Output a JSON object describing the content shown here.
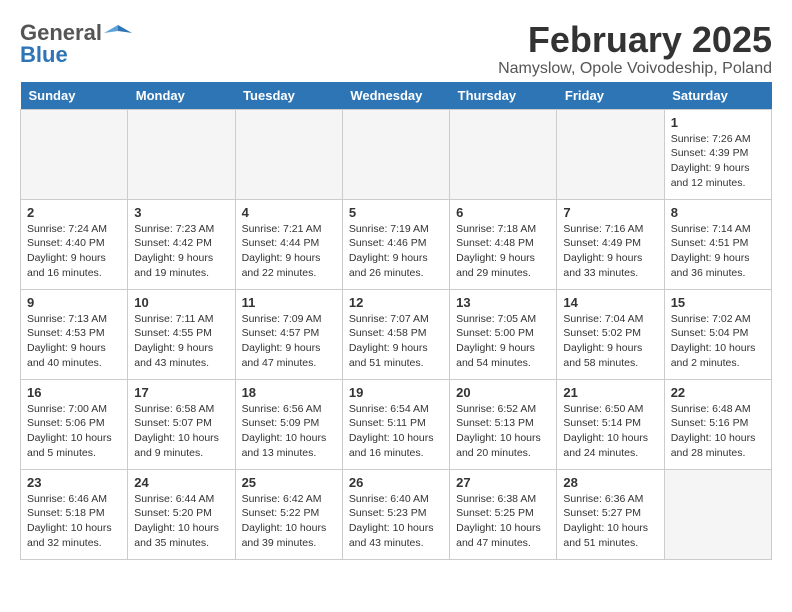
{
  "header": {
    "logo_general": "General",
    "logo_blue": "Blue",
    "title": "February 2025",
    "subtitle": "Namyslow, Opole Voivodeship, Poland"
  },
  "columns": [
    "Sunday",
    "Monday",
    "Tuesday",
    "Wednesday",
    "Thursday",
    "Friday",
    "Saturday"
  ],
  "weeks": [
    [
      {
        "day": "",
        "info": ""
      },
      {
        "day": "",
        "info": ""
      },
      {
        "day": "",
        "info": ""
      },
      {
        "day": "",
        "info": ""
      },
      {
        "day": "",
        "info": ""
      },
      {
        "day": "",
        "info": ""
      },
      {
        "day": "1",
        "info": "Sunrise: 7:26 AM\nSunset: 4:39 PM\nDaylight: 9 hours and 12 minutes."
      }
    ],
    [
      {
        "day": "2",
        "info": "Sunrise: 7:24 AM\nSunset: 4:40 PM\nDaylight: 9 hours and 16 minutes."
      },
      {
        "day": "3",
        "info": "Sunrise: 7:23 AM\nSunset: 4:42 PM\nDaylight: 9 hours and 19 minutes."
      },
      {
        "day": "4",
        "info": "Sunrise: 7:21 AM\nSunset: 4:44 PM\nDaylight: 9 hours and 22 minutes."
      },
      {
        "day": "5",
        "info": "Sunrise: 7:19 AM\nSunset: 4:46 PM\nDaylight: 9 hours and 26 minutes."
      },
      {
        "day": "6",
        "info": "Sunrise: 7:18 AM\nSunset: 4:48 PM\nDaylight: 9 hours and 29 minutes."
      },
      {
        "day": "7",
        "info": "Sunrise: 7:16 AM\nSunset: 4:49 PM\nDaylight: 9 hours and 33 minutes."
      },
      {
        "day": "8",
        "info": "Sunrise: 7:14 AM\nSunset: 4:51 PM\nDaylight: 9 hours and 36 minutes."
      }
    ],
    [
      {
        "day": "9",
        "info": "Sunrise: 7:13 AM\nSunset: 4:53 PM\nDaylight: 9 hours and 40 minutes."
      },
      {
        "day": "10",
        "info": "Sunrise: 7:11 AM\nSunset: 4:55 PM\nDaylight: 9 hours and 43 minutes."
      },
      {
        "day": "11",
        "info": "Sunrise: 7:09 AM\nSunset: 4:57 PM\nDaylight: 9 hours and 47 minutes."
      },
      {
        "day": "12",
        "info": "Sunrise: 7:07 AM\nSunset: 4:58 PM\nDaylight: 9 hours and 51 minutes."
      },
      {
        "day": "13",
        "info": "Sunrise: 7:05 AM\nSunset: 5:00 PM\nDaylight: 9 hours and 54 minutes."
      },
      {
        "day": "14",
        "info": "Sunrise: 7:04 AM\nSunset: 5:02 PM\nDaylight: 9 hours and 58 minutes."
      },
      {
        "day": "15",
        "info": "Sunrise: 7:02 AM\nSunset: 5:04 PM\nDaylight: 10 hours and 2 minutes."
      }
    ],
    [
      {
        "day": "16",
        "info": "Sunrise: 7:00 AM\nSunset: 5:06 PM\nDaylight: 10 hours and 5 minutes."
      },
      {
        "day": "17",
        "info": "Sunrise: 6:58 AM\nSunset: 5:07 PM\nDaylight: 10 hours and 9 minutes."
      },
      {
        "day": "18",
        "info": "Sunrise: 6:56 AM\nSunset: 5:09 PM\nDaylight: 10 hours and 13 minutes."
      },
      {
        "day": "19",
        "info": "Sunrise: 6:54 AM\nSunset: 5:11 PM\nDaylight: 10 hours and 16 minutes."
      },
      {
        "day": "20",
        "info": "Sunrise: 6:52 AM\nSunset: 5:13 PM\nDaylight: 10 hours and 20 minutes."
      },
      {
        "day": "21",
        "info": "Sunrise: 6:50 AM\nSunset: 5:14 PM\nDaylight: 10 hours and 24 minutes."
      },
      {
        "day": "22",
        "info": "Sunrise: 6:48 AM\nSunset: 5:16 PM\nDaylight: 10 hours and 28 minutes."
      }
    ],
    [
      {
        "day": "23",
        "info": "Sunrise: 6:46 AM\nSunset: 5:18 PM\nDaylight: 10 hours and 32 minutes."
      },
      {
        "day": "24",
        "info": "Sunrise: 6:44 AM\nSunset: 5:20 PM\nDaylight: 10 hours and 35 minutes."
      },
      {
        "day": "25",
        "info": "Sunrise: 6:42 AM\nSunset: 5:22 PM\nDaylight: 10 hours and 39 minutes."
      },
      {
        "day": "26",
        "info": "Sunrise: 6:40 AM\nSunset: 5:23 PM\nDaylight: 10 hours and 43 minutes."
      },
      {
        "day": "27",
        "info": "Sunrise: 6:38 AM\nSunset: 5:25 PM\nDaylight: 10 hours and 47 minutes."
      },
      {
        "day": "28",
        "info": "Sunrise: 6:36 AM\nSunset: 5:27 PM\nDaylight: 10 hours and 51 minutes."
      },
      {
        "day": "",
        "info": ""
      }
    ]
  ]
}
